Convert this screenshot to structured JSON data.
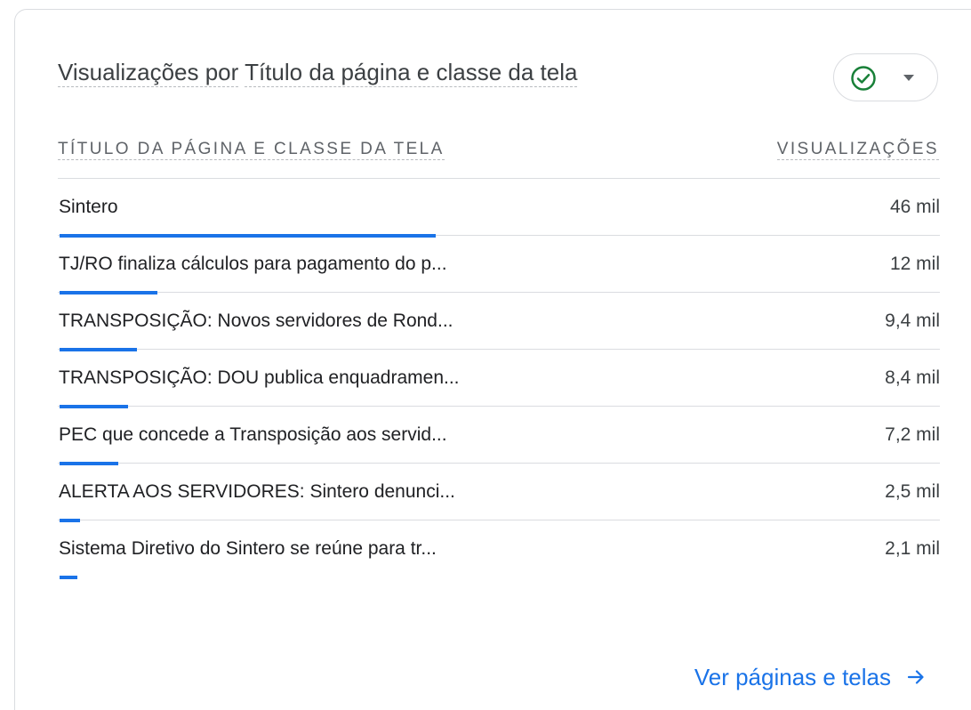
{
  "card": {
    "title_prefix": "Visualizações por",
    "title_dimension": "Título da página e classe da tela",
    "status_icon": "check-circle-icon",
    "status_color": "#188038"
  },
  "table": {
    "col_dimension": "TÍTULO DA PÁGINA E CLASSE DA TELA",
    "col_metric": "VISUALIZAÇÕES",
    "bar_color": "#1a73e8",
    "rows": [
      {
        "label": "Sintero",
        "value": "46 mil",
        "share": 1.0
      },
      {
        "label": "TJ/RO finaliza cálculos para pagamento do p...",
        "value": "12 mil",
        "share": 0.26
      },
      {
        "label": "TRANSPOSIÇÃO: Novos servidores de Rond...",
        "value": "9,4 mil",
        "share": 0.205
      },
      {
        "label": "TRANSPOSIÇÃO: DOU publica enquadramen...",
        "value": "8,4 mil",
        "share": 0.183
      },
      {
        "label": "PEC que concede a Transposição aos servid...",
        "value": "7,2 mil",
        "share": 0.157
      },
      {
        "label": "ALERTA AOS SERVIDORES: Sintero denunci...",
        "value": "2,5 mil",
        "share": 0.054
      },
      {
        "label": "Sistema Diretivo do Sintero se reúne para tr...",
        "value": "2,1 mil",
        "share": 0.046
      }
    ]
  },
  "footer": {
    "link_label": "Ver páginas e telas",
    "link_icon": "arrow-right-icon"
  }
}
